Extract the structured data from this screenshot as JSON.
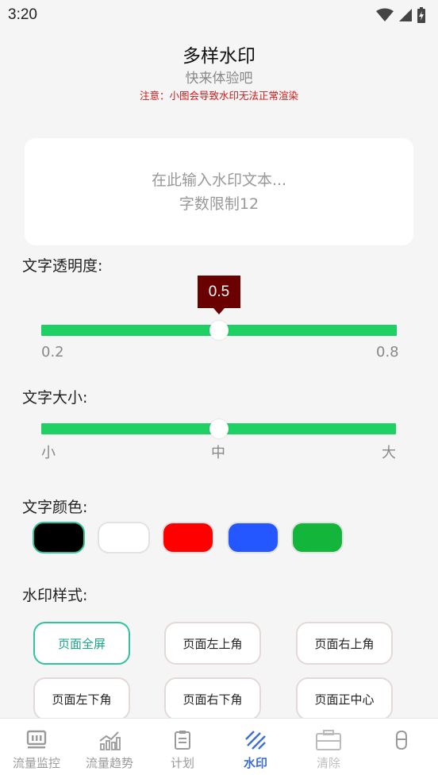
{
  "status_bar": {
    "time": "3:20"
  },
  "header": {
    "title": "多样水印",
    "subtitle": "快来体验吧",
    "notice": "注意：小图会导致水印无法正常渲染"
  },
  "text_input": {
    "placeholder_line1": "在此输入水印文本...",
    "placeholder_line2": "字数限制12"
  },
  "opacity": {
    "label": "文字透明度:",
    "value": "0.5",
    "min_label": "0.2",
    "max_label": "0.8"
  },
  "size": {
    "label": "文字大小:",
    "ticks": [
      "小",
      "中",
      "大"
    ],
    "selected": "中"
  },
  "color": {
    "label": "文字颜色:",
    "swatches": [
      "#000000",
      "#ffffff",
      "#ff0000",
      "#2457ff",
      "#13b53b"
    ],
    "selected_index": 0
  },
  "style": {
    "label": "水印样式:",
    "options": [
      "页面全屏",
      "页面左上角",
      "页面右上角",
      "页面左下角",
      "页面右下角",
      "页面正中心"
    ],
    "selected_index": 0
  },
  "nav": {
    "items": [
      "流量监控",
      "流量趋势",
      "计划",
      "水印",
      "清除",
      ""
    ],
    "active_index": 3,
    "active_color": "#3d6fd6"
  }
}
